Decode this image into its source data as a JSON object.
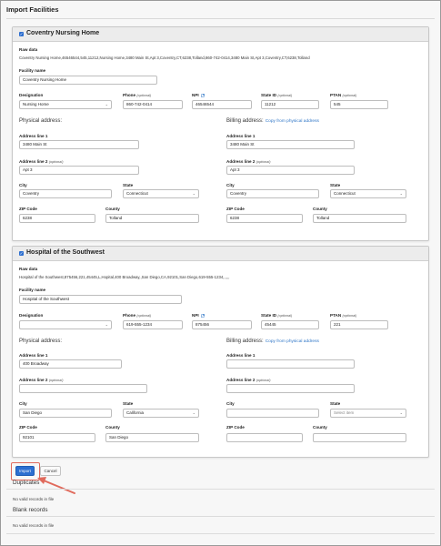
{
  "page": {
    "title": "Import Facilities"
  },
  "labels": {
    "raw_data": "Raw data",
    "facility_name": "Facility name",
    "designation": "Designation",
    "phone": "Phone",
    "optional": "(optional)",
    "npi": "NPI",
    "state_id": "State ID",
    "ptan": "PTAN",
    "physical_address": "Physical address:",
    "billing_address": "Billing address:",
    "copy_link": "Copy from physical address",
    "address_line1": "Address line 1",
    "address_line2": "Address line 2",
    "city": "City",
    "state": "State",
    "zip": "ZIP Code",
    "county": "County"
  },
  "facilities": [
    {
      "checked": true,
      "title": "Coventry Nursing Home",
      "raw": "Coventry Nursing Home,46546544,545,11212,Nursing Home,3480 Main St,Apt 3,Coventry,CT,6238,Tolland,860-742-0414,3480 Main St,Apt 3,Coventry,CT,6238,Tolland",
      "facility_name": "Coventry Nursing Home",
      "designation": "Nursing Home",
      "phone": "860-742-0414",
      "npi": "46546544",
      "state_id": "11212",
      "ptan": "545",
      "physical": {
        "line1": "3480 Main St",
        "line2": "Apt 3",
        "city": "Coventry",
        "state": "Connecticut",
        "zip": "6238",
        "county": "Tolland"
      },
      "billing": {
        "line1": "3480 Main St",
        "line2": "Apt 3",
        "city": "Coventry",
        "state": "Connecticut",
        "zip": "6238",
        "county": "Tolland"
      }
    },
    {
      "checked": true,
      "title": "Hospital of the Southwest",
      "raw": "Hospital of the Southwest,875456,221,45445,L,Hopital,400 Broadway,,San Diego,CA,92101,San Diego,619-555-1234,,,,,,",
      "facility_name": "Hospital of the Southwest",
      "designation": "",
      "phone": "619-555-1234",
      "npi": "875456",
      "state_id": "45445",
      "ptan": "221",
      "physical": {
        "line1": "400 Broadway",
        "line2": "",
        "city": "San Diego",
        "state": "California",
        "zip": "92101",
        "county": "San Diego"
      },
      "billing": {
        "line1": "",
        "line2": "",
        "city": "",
        "state": "Select item",
        "zip": "",
        "county": ""
      }
    }
  ],
  "actions": {
    "import_label": "Import",
    "cancel_label": "Cancel"
  },
  "duplicates": {
    "title": "Duplicates",
    "message": "No valid records in file"
  },
  "blank_records": {
    "title": "Blank records",
    "message": "No valid records in file"
  },
  "colors": {
    "primary": "#2d6fd0",
    "link": "#2f76c7",
    "highlight": "#e06a5c"
  }
}
